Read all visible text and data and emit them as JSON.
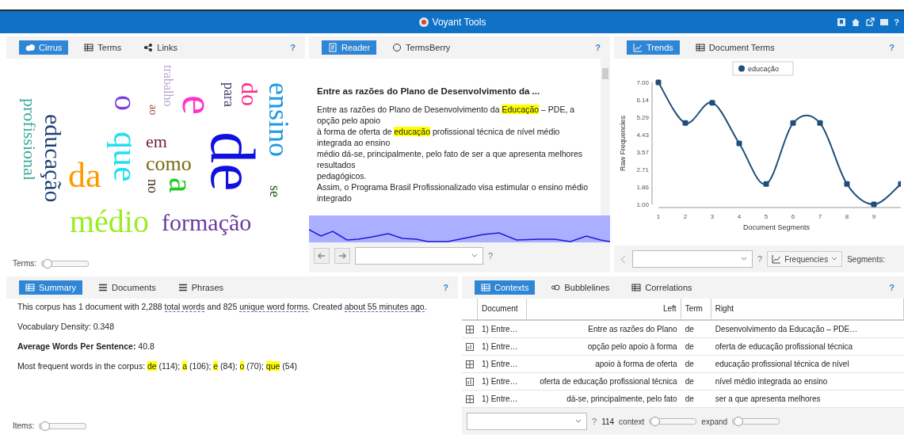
{
  "app": {
    "title": "Voyant Tools",
    "help": "?"
  },
  "cirrus": {
    "tabs": [
      {
        "label": "Cirrus",
        "selected": true
      },
      {
        "label": "Terms",
        "selected": false
      },
      {
        "label": "Links",
        "selected": false
      }
    ],
    "help": "?",
    "words": [
      {
        "text": "trabalho",
        "color": "#b7a6d2",
        "vertical": true
      },
      {
        "text": "profissional",
        "color": "#3aa99b",
        "vertical": true
      },
      {
        "text": "educação",
        "color": "#1f3f78",
        "vertical": true
      },
      {
        "text": "o",
        "color": "#7b3fe0",
        "vertical": true
      },
      {
        "text": "ao",
        "color": "#a0504a",
        "vertical": true
      },
      {
        "text": "e",
        "color": "#ff33cc",
        "vertical": true
      },
      {
        "text": "para",
        "color": "#3a3a6a",
        "vertical": true
      },
      {
        "text": "do",
        "color": "#ff2a8a",
        "vertical": true
      },
      {
        "text": "ensino",
        "color": "#1e9ae0",
        "vertical": true
      },
      {
        "text": "em",
        "color": "#7a2040",
        "vertical": false
      },
      {
        "text": "que",
        "color": "#22e0f0",
        "vertical": true
      },
      {
        "text": "da",
        "color": "#ff9900",
        "vertical": false
      },
      {
        "text": "como",
        "color": "#7a6a10",
        "vertical": false
      },
      {
        "text": "no",
        "color": "#3a2a10",
        "vertical": true
      },
      {
        "text": "a",
        "color": "#22cc22",
        "vertical": true
      },
      {
        "text": "de",
        "color": "#1010e0",
        "vertical": true
      },
      {
        "text": "se",
        "color": "#1a5a1a",
        "vertical": true
      },
      {
        "text": "médio",
        "color": "#99ee22",
        "vertical": false
      },
      {
        "text": "formação",
        "color": "#6a3aa0",
        "vertical": false
      }
    ],
    "terms_label": "Terms:",
    "terms_slider": {
      "level": 0.05
    }
  },
  "reader": {
    "tabs": [
      {
        "label": "Reader",
        "selected": true
      },
      {
        "label": "TermsBerry",
        "selected": false
      }
    ],
    "help": "?",
    "heading": "Entre as razões do Plano de Desenvolvimento da ...",
    "lines": [
      [
        {
          "text": "Entre as razões do Plano de Desenvolvimento da ",
          "highlight": false
        },
        {
          "text": "Educação",
          "highlight": true
        },
        {
          "text": " – PDE, a opção pelo apoio",
          "highlight": false
        }
      ],
      [
        {
          "text": "à forma de oferta de ",
          "highlight": false
        },
        {
          "text": "educação",
          "highlight": true
        },
        {
          "text": " profissional técnica de nível médio integrada ao ensino",
          "highlight": false
        }
      ],
      [
        {
          "text": "médio dá-se, principalmente, pelo fato de ser a que apresenta melhores resultados",
          "highlight": false
        }
      ],
      [
        {
          "text": "pedagógicos.",
          "highlight": false
        }
      ],
      [
        {
          "text": "Assim, o Programa Brasil Profissionalizado visa estimular o ensino médio integrado",
          "highlight": false
        }
      ]
    ],
    "footer_help": "?"
  },
  "trends": {
    "tabs": [
      {
        "label": "Trends",
        "selected": true
      },
      {
        "label": "Document Terms",
        "selected": false
      }
    ],
    "help": "?",
    "chart_data": {
      "type": "line",
      "xlabel": "Document Segments",
      "ylabel": "Raw Frequencies",
      "x": [
        1,
        2,
        3,
        4,
        5,
        6,
        7,
        8,
        9,
        10
      ],
      "series": [
        {
          "name": "educação",
          "color": "#1f4e79",
          "marker": true,
          "values": [
            7,
            5,
            6,
            4,
            2,
            5,
            5,
            2,
            1,
            2
          ]
        }
      ],
      "xlim": [
        1,
        10
      ],
      "xticks": [
        1,
        2,
        3,
        4,
        5,
        6,
        7,
        8,
        9
      ],
      "yticks": [
        {
          "value": 1,
          "label": "1.00"
        },
        {
          "value": 1.857,
          "label": "1.86"
        },
        {
          "value": 2.714,
          "label": "2.71"
        },
        {
          "value": 3.571,
          "label": "3.57"
        },
        {
          "value": 4.429,
          "label": "4.43"
        },
        {
          "value": 5.286,
          "label": "5.29"
        },
        {
          "value": 6.143,
          "label": "6.14"
        },
        {
          "value": 7,
          "label": "7.00"
        }
      ],
      "ylim": [
        1,
        7
      ]
    },
    "footer_help": "?",
    "mode_button": "Frequencies",
    "segments_label": "Segments:"
  },
  "summary": {
    "tabs": [
      {
        "label": "Summary",
        "selected": true
      },
      {
        "label": "Documents",
        "selected": false
      },
      {
        "label": "Phrases",
        "selected": false
      }
    ],
    "help": "?",
    "paragraphs": [
      [
        {
          "text": "This corpus has 1 document with 2,288 ",
          "kind": "plain"
        },
        {
          "text": "total words",
          "kind": "link"
        },
        {
          "text": " and 825 ",
          "kind": "plain"
        },
        {
          "text": "unique word forms",
          "kind": "link"
        },
        {
          "text": ". Created ",
          "kind": "plain"
        },
        {
          "text": "about 55 minutes ago",
          "kind": "link"
        },
        {
          "text": ".",
          "kind": "plain"
        }
      ],
      [
        {
          "text": "Vocabulary Density: 0.348",
          "kind": "plain"
        }
      ],
      [
        {
          "text": "Average Words Per Sentence:",
          "kind": "label"
        },
        {
          "text": " 40.8",
          "kind": "plain"
        }
      ],
      [
        {
          "text": "Most frequent words in the corpus: ",
          "kind": "plain"
        },
        {
          "text": "de",
          "kind": "term"
        },
        {
          "text": " (114); ",
          "kind": "plain"
        },
        {
          "text": "a",
          "kind": "term"
        },
        {
          "text": " (106); ",
          "kind": "plain"
        },
        {
          "text": "e",
          "kind": "term"
        },
        {
          "text": " (84); ",
          "kind": "plain"
        },
        {
          "text": "o",
          "kind": "term"
        },
        {
          "text": " (70); ",
          "kind": "plain"
        },
        {
          "text": "que",
          "kind": "term"
        },
        {
          "text": " (54)",
          "kind": "plain"
        }
      ]
    ],
    "items_label": "Items:",
    "items_slider": {
      "level": 0.05
    }
  },
  "contexts": {
    "tabs": [
      {
        "label": "Contexts",
        "selected": true
      },
      {
        "label": "Bubblelines",
        "selected": false
      },
      {
        "label": "Correlations",
        "selected": false
      }
    ],
    "help": "?",
    "columns": [
      "Document",
      "Left",
      "Term",
      "Right"
    ],
    "rows": [
      [
        "1) Entre…",
        "Entre as razões do Plano",
        "de",
        "Desenvolvimento da Educação – PDE…"
      ],
      [
        "1) Entre…",
        "opção pelo apoio à forma",
        "de",
        "oferta de educação profissional técnica"
      ],
      [
        "1) Entre…",
        "apoio à forma de oferta",
        "de",
        "educação profissional técnica de nível"
      ],
      [
        "1) Entre…",
        "oferta de educação profissional técnica",
        "de",
        "nível médio integrada ao ensino"
      ],
      [
        "1) Entre…",
        "dá-se, principalmente, pelo fato",
        "de",
        "ser a que apresenta melhores"
      ]
    ],
    "footer_help": "?",
    "count": "114",
    "context_label": "context",
    "context_slider": {
      "level": 0.05
    },
    "expand_label": "expand",
    "expand_slider": {
      "level": 0.05
    }
  }
}
